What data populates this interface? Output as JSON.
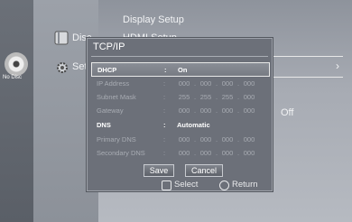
{
  "background_menu": {
    "top_items": [
      "Display Setup",
      "HDMI Setup"
    ],
    "side_items": [
      {
        "label": "Disc",
        "icon": "disc-menu-icon"
      },
      {
        "label": "Setu",
        "icon": "setup-gear-icon"
      }
    ],
    "no_disc_label": "No Disc",
    "right_value": "Off"
  },
  "dialog": {
    "title": "TCP/IP",
    "rows": [
      {
        "label": "DHCP",
        "colon": ":",
        "value": "On",
        "type": "text",
        "highlight": true,
        "enabled": true
      },
      {
        "label": "IP Address",
        "colon": ":",
        "octets": [
          "000",
          "000",
          "000",
          "000"
        ],
        "type": "ip",
        "enabled": false
      },
      {
        "label": "Subnet Mask",
        "colon": ":",
        "octets": [
          "255",
          "255",
          "255",
          "000"
        ],
        "type": "ip",
        "enabled": false
      },
      {
        "label": "Gateway",
        "colon": ":",
        "octets": [
          "000",
          "000",
          "000",
          "000"
        ],
        "type": "ip",
        "enabled": false
      },
      {
        "label": "DNS",
        "colon": ":",
        "value": "Automatic",
        "type": "text",
        "enabled": true
      },
      {
        "label": "Primary DNS",
        "colon": ":",
        "octets": [
          "000",
          "000",
          "000",
          "000"
        ],
        "type": "ip",
        "enabled": false
      },
      {
        "label": "Secondary DNS",
        "colon": ":",
        "octets": [
          "000",
          "000",
          "000",
          "000"
        ],
        "type": "ip",
        "enabled": false
      }
    ],
    "buttons": {
      "save": "Save",
      "cancel": "Cancel"
    },
    "footer": {
      "select": "Select",
      "return": "Return"
    }
  }
}
